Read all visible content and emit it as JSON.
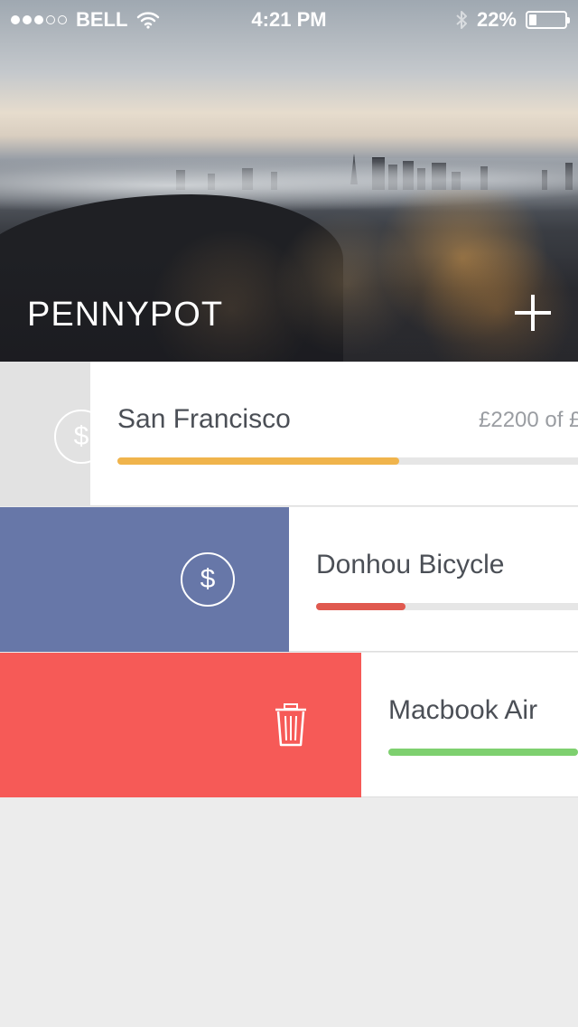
{
  "status_bar": {
    "carrier": "BELL",
    "time": "4:21 PM",
    "battery_percent": "22%",
    "battery_level": 0.22,
    "signal_bars_filled": 3,
    "signal_bars_total": 5
  },
  "header": {
    "title": "PENNYPOT",
    "add_icon": "plus-icon"
  },
  "goals": [
    {
      "name": "San Francisco",
      "amount_text": "£2200 of £",
      "progress": 0.6,
      "bar_color": "#f0b44c",
      "action": "deposit",
      "action_icon": "dollar-icon",
      "action_bg": "#e2e2e2"
    },
    {
      "name": "Donhou Bicycle",
      "progress": 0.3,
      "bar_color": "#e0594f",
      "action": "deposit",
      "action_icon": "dollar-icon",
      "action_bg": "#6777a8"
    },
    {
      "name": "Macbook Air",
      "progress": 1.0,
      "bar_color": "#7ed06f",
      "action": "delete",
      "action_icon": "trash-icon",
      "action_bg": "#f65a57"
    }
  ],
  "icons": {
    "dollar_glyph": "$"
  }
}
